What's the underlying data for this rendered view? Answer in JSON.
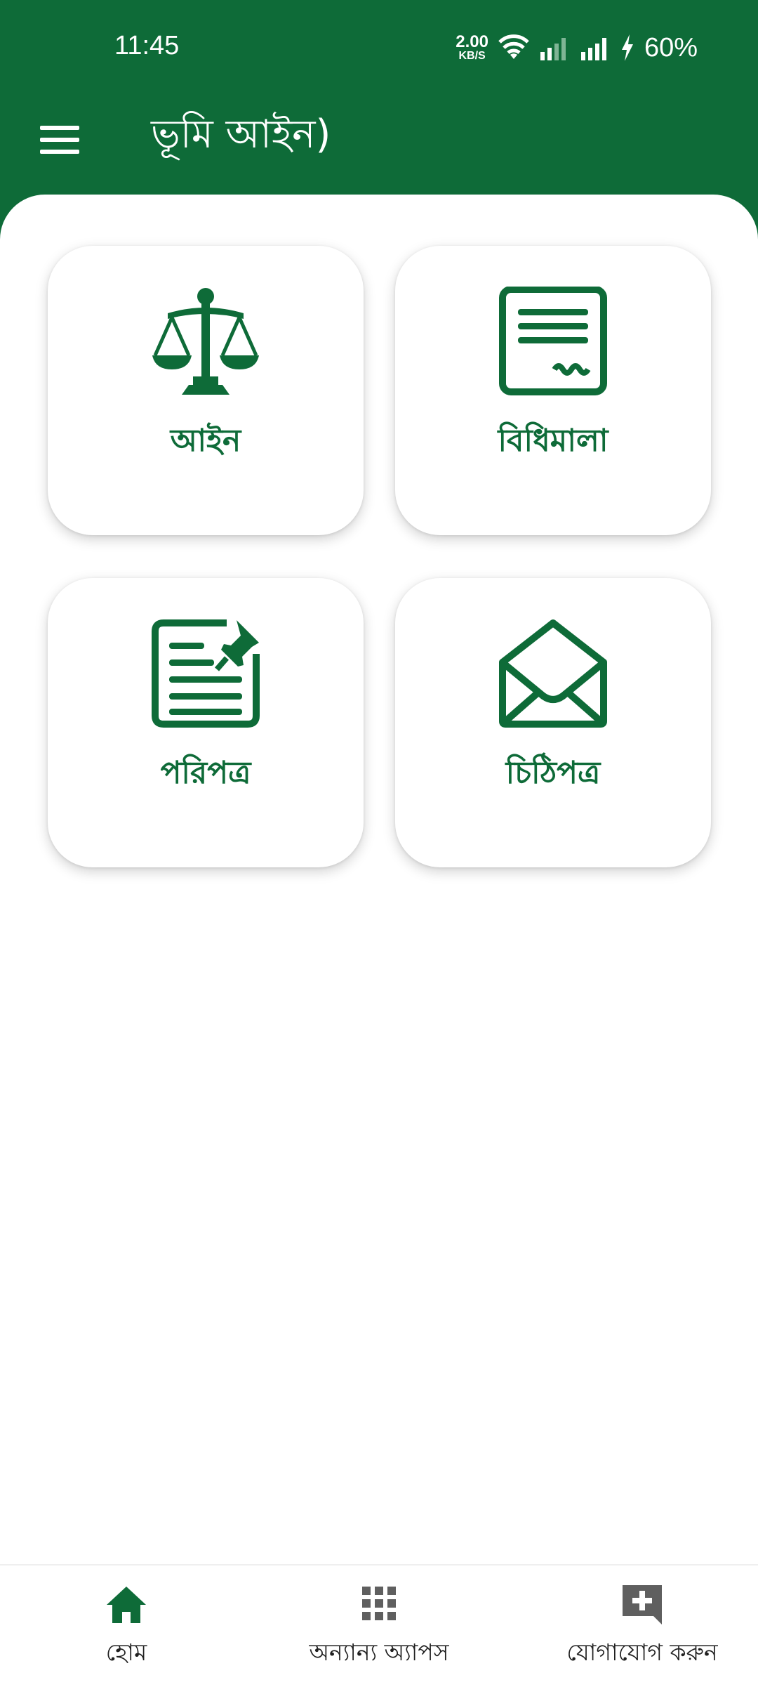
{
  "status_bar": {
    "time": "11:45",
    "net_speed_value": "2.00",
    "net_speed_unit": "KB/S",
    "battery": "60%",
    "icons": [
      "wifi-icon",
      "signal-weak-icon",
      "signal-icon",
      "charging-icon"
    ]
  },
  "app_bar": {
    "title": "ভূমি আইন)",
    "menu_icon": "hamburger-menu-icon"
  },
  "cards": [
    {
      "label": "আইন",
      "icon": "scales-of-justice-icon"
    },
    {
      "label": "বিধিমালা",
      "icon": "document-icon"
    },
    {
      "label": "পরিপত্র",
      "icon": "pinned-document-icon"
    },
    {
      "label": "চিঠিপত্র",
      "icon": "envelope-icon"
    }
  ],
  "bottom_nav": [
    {
      "label": "হোম",
      "icon": "home-icon",
      "active": true
    },
    {
      "label": "অন্যান্য অ্যাপস",
      "icon": "apps-grid-icon",
      "active": false
    },
    {
      "label": "যোগাযোগ করুন",
      "icon": "add-comment-icon",
      "active": false
    }
  ],
  "colors": {
    "primary": "#0e6b38",
    "background": "#ffffff",
    "nav_inactive": "#5f5f5f"
  }
}
